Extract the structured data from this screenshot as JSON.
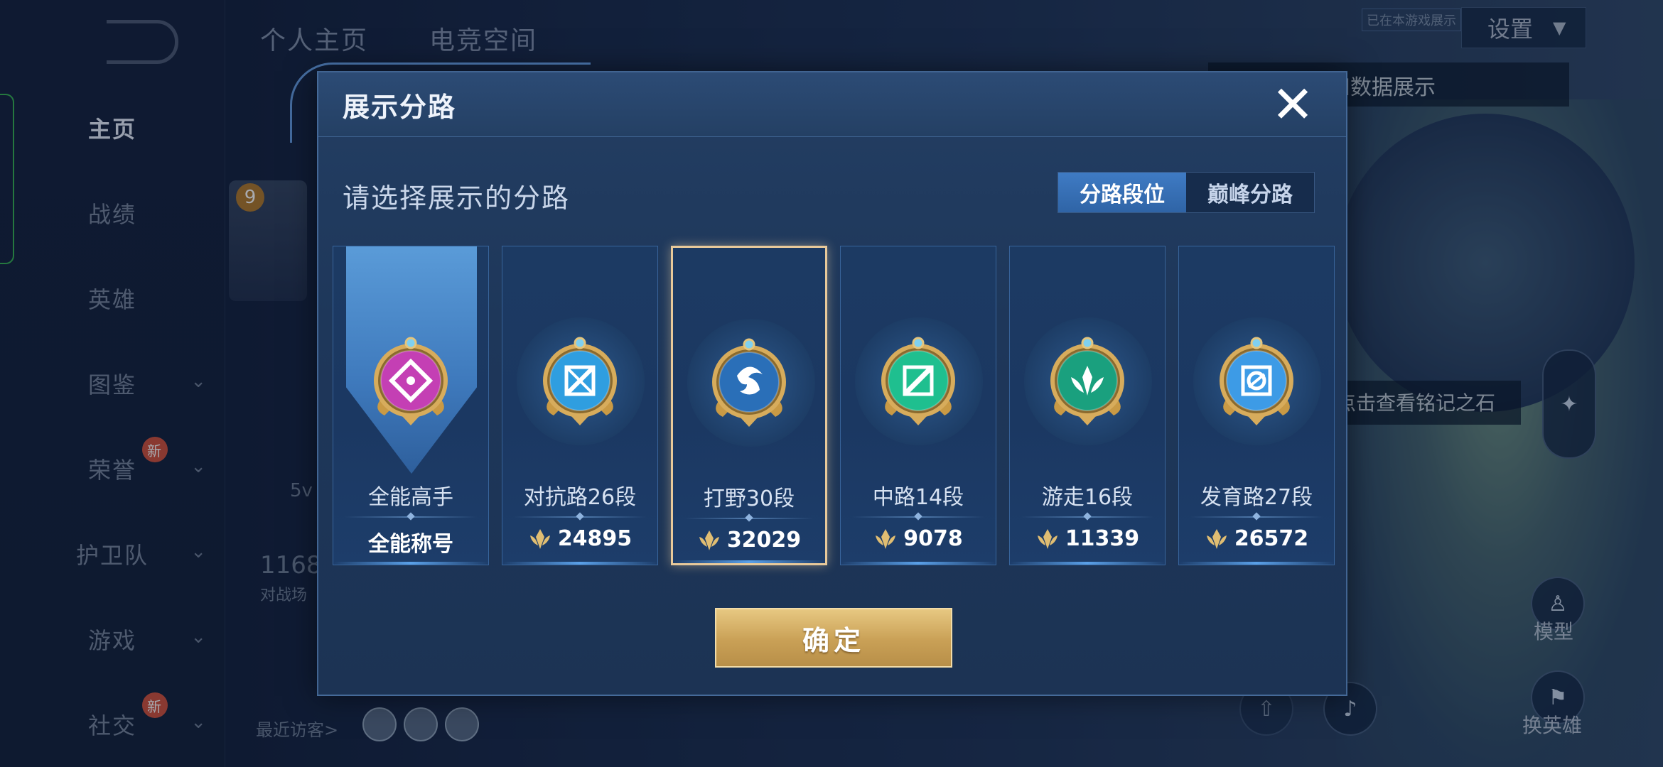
{
  "nav": {
    "items": [
      {
        "label": "主页",
        "active": true,
        "chevron": false,
        "badge": ""
      },
      {
        "label": "战绩",
        "active": false,
        "chevron": false,
        "badge": ""
      },
      {
        "label": "英雄",
        "active": false,
        "chevron": false,
        "badge": ""
      },
      {
        "label": "图鉴",
        "active": false,
        "chevron": true,
        "badge": ""
      },
      {
        "label": "荣誉",
        "active": false,
        "chevron": true,
        "badge": "新"
      },
      {
        "label": "护卫队",
        "active": false,
        "chevron": true,
        "badge": ""
      },
      {
        "label": "游戏",
        "active": false,
        "chevron": true,
        "badge": ""
      },
      {
        "label": "社交",
        "active": false,
        "chevron": true,
        "badge": "新"
      }
    ]
  },
  "background": {
    "tabs": [
      "个人主页",
      "电竞空间"
    ],
    "settings_label": "设置",
    "hint_top": "以切换灵宝和数据展示",
    "hint_mid": "点击查看铭记之石",
    "level": "9",
    "mode_text": "5v",
    "stat_number": "1168",
    "stat_label": "对战场",
    "recent_visitors": "最近访客>",
    "model_label": "模型",
    "switch_hero_label": "换英雄",
    "small_badge": "已在本游戏展示"
  },
  "modal": {
    "title": "展示分路",
    "subtitle": "请选择展示的分路",
    "toggle": {
      "options": [
        "分路段位",
        "巅峰分路"
      ],
      "active_index": 0
    },
    "cards": [
      {
        "title": "全能高手",
        "value": "全能称号",
        "show_coin": false,
        "selected": false,
        "emblem_color": "#c43fb4",
        "emblem": "allround-emblem"
      },
      {
        "title": "对抗路26段",
        "value": "24895",
        "show_coin": true,
        "selected": false,
        "emblem_color": "#2f9ee0",
        "emblem": "clash-lane-emblem"
      },
      {
        "title": "打野30段",
        "value": "32029",
        "show_coin": true,
        "selected": true,
        "emblem_color": "#2a6fb8",
        "emblem": "jungle-dragon-emblem"
      },
      {
        "title": "中路14段",
        "value": "9078",
        "show_coin": true,
        "selected": false,
        "emblem_color": "#1fbf8f",
        "emblem": "mid-lane-emblem"
      },
      {
        "title": "游走16段",
        "value": "11339",
        "show_coin": true,
        "selected": false,
        "emblem_color": "#1aa07e",
        "emblem": "roam-emblem"
      },
      {
        "title": "发育路27段",
        "value": "26572",
        "show_coin": true,
        "selected": false,
        "emblem_color": "#3d9be6",
        "emblem": "farm-lane-emblem"
      }
    ],
    "confirm_label": "确定",
    "close_icon": "close-icon"
  },
  "colors": {
    "accent_gold": "#d4b06a",
    "selected_border": "#e8c99a",
    "toggle_active": "#3a74bd"
  }
}
